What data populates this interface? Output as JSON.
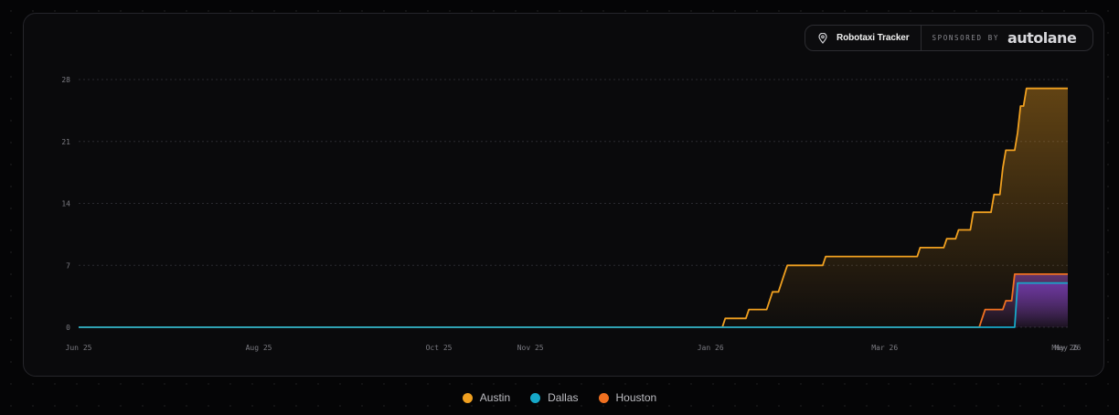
{
  "badge": {
    "title": "Robotaxi Tracker",
    "sponsored_label": "SPONSORED BY",
    "brand": "autolane",
    "icon": "location-pin-icon"
  },
  "chart_data": {
    "type": "line",
    "title": "",
    "xlabel": "",
    "ylabel": "",
    "ylim": [
      0,
      28
    ],
    "yticks": [
      0,
      7,
      14,
      21,
      28
    ],
    "x_ticks": [
      {
        "label": "Jun 25",
        "date": "2025-06-01"
      },
      {
        "label": "Aug 25",
        "date": "2025-08-01"
      },
      {
        "label": "Oct 25",
        "date": "2025-10-01"
      },
      {
        "label": "Nov 25",
        "date": "2025-11-01"
      },
      {
        "label": "Jan 26",
        "date": "2026-01-01"
      },
      {
        "label": "Mar 26",
        "date": "2026-03-01"
      },
      {
        "label": "May 26",
        "date": "2026-05-01"
      },
      {
        "label": "May 26",
        "date": "2026-05-02"
      }
    ],
    "xlim": [
      "2025-06-01",
      "2026-05-02"
    ],
    "grid": true,
    "legend_position": "bottom-center",
    "series": [
      {
        "name": "Austin",
        "color": "#f0a020",
        "points": [
          [
            "2025-06-01",
            0
          ],
          [
            "2026-01-05",
            0
          ],
          [
            "2026-01-06",
            1
          ],
          [
            "2026-01-13",
            1
          ],
          [
            "2026-01-14",
            2
          ],
          [
            "2026-01-20",
            2
          ],
          [
            "2026-01-21",
            3
          ],
          [
            "2026-01-22",
            4
          ],
          [
            "2026-01-24",
            4
          ],
          [
            "2026-01-25",
            5
          ],
          [
            "2026-01-26",
            6
          ],
          [
            "2026-01-27",
            7
          ],
          [
            "2026-02-08",
            7
          ],
          [
            "2026-02-09",
            8
          ],
          [
            "2026-03-12",
            8
          ],
          [
            "2026-03-13",
            9
          ],
          [
            "2026-03-21",
            9
          ],
          [
            "2026-03-22",
            10
          ],
          [
            "2026-03-25",
            10
          ],
          [
            "2026-03-26",
            11
          ],
          [
            "2026-03-30",
            11
          ],
          [
            "2026-03-31",
            13
          ],
          [
            "2026-04-06",
            13
          ],
          [
            "2026-04-07",
            15
          ],
          [
            "2026-04-09",
            15
          ],
          [
            "2026-04-10",
            18
          ],
          [
            "2026-04-11",
            20
          ],
          [
            "2026-04-14",
            20
          ],
          [
            "2026-04-15",
            22
          ],
          [
            "2026-04-16",
            25
          ],
          [
            "2026-04-17",
            25
          ],
          [
            "2026-04-18",
            27
          ],
          [
            "2026-05-02",
            27
          ]
        ]
      },
      {
        "name": "Dallas",
        "color": "#16a8c8",
        "points": [
          [
            "2025-06-01",
            0
          ],
          [
            "2026-04-14",
            0
          ],
          [
            "2026-04-15",
            5
          ],
          [
            "2026-05-02",
            5
          ]
        ]
      },
      {
        "name": "Houston",
        "color": "#f07020",
        "points": [
          [
            "2025-06-01",
            0
          ],
          [
            "2026-04-02",
            0
          ],
          [
            "2026-04-03",
            1
          ],
          [
            "2026-04-04",
            2
          ],
          [
            "2026-04-10",
            2
          ],
          [
            "2026-04-11",
            3
          ],
          [
            "2026-04-13",
            3
          ],
          [
            "2026-04-14",
            6
          ],
          [
            "2026-05-02",
            6
          ]
        ]
      }
    ]
  }
}
